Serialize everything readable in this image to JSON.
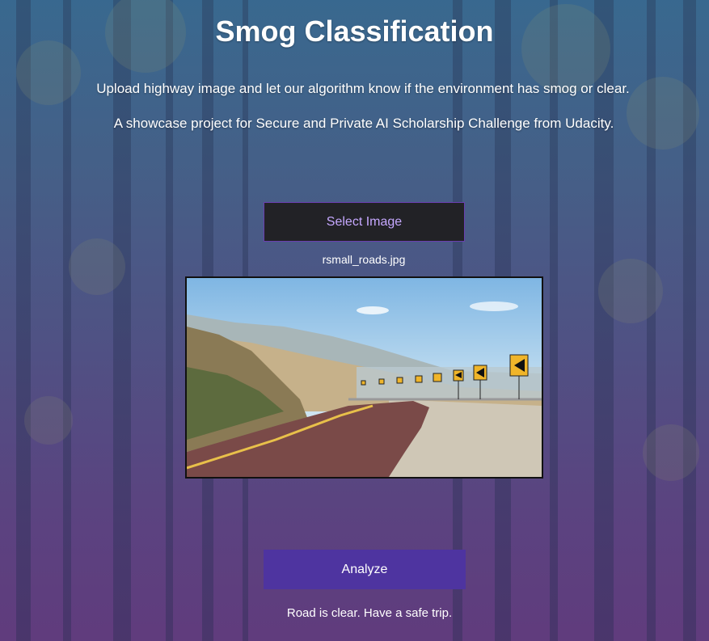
{
  "header": {
    "title": "Smog Classification",
    "description": "Upload highway image and let our algorithm know if the environment has smog or clear.",
    "showcase": "A showcase project for Secure and Private AI Scholarship Challenge from Udacity."
  },
  "upload": {
    "select_label": "Select Image",
    "filename": "rsmall_roads.jpg"
  },
  "actions": {
    "analyze_label": "Analyze"
  },
  "result": {
    "message": "Road is clear. Have a safe trip."
  },
  "colors": {
    "select_button_bg": "#222226",
    "select_button_text": "#c6a8ff",
    "analyze_button_bg": "#4e34a0"
  },
  "icons": {
    "preview": "road-photo"
  }
}
